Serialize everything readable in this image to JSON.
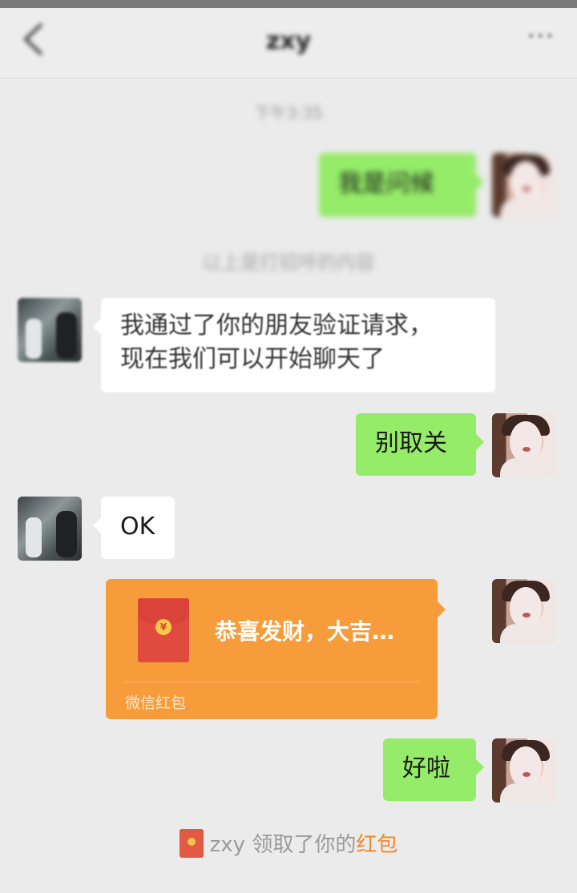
{
  "header": {
    "back_icon": "back-arrow-icon",
    "title": "zxy",
    "more_icon": "more-icon",
    "more_label": "···"
  },
  "chat": {
    "time": "下午3:35",
    "system_notice": "以上是打招呼的内容",
    "messages": [
      {
        "from": "me",
        "text": "我是问候"
      },
      {
        "from": "other",
        "line1": "我通过了你的朋友验证请求，",
        "line2": "现在我们可以开始聊天了"
      },
      {
        "from": "me",
        "text": "别取关"
      },
      {
        "from": "other",
        "text": "OK"
      },
      {
        "from": "me",
        "type": "red_packet",
        "text": "恭喜发财，大吉…",
        "label": "微信红包",
        "coin": "¥"
      },
      {
        "from": "me",
        "text": "好啦"
      }
    ],
    "receipt": {
      "name": "zxy",
      "text": " 领取了你的",
      "link": "红包"
    }
  },
  "colors": {
    "background": "#ebebeb",
    "bubble_me": "#95ec69",
    "bubble_other": "#ffffff",
    "red_packet": "#f79c3b",
    "link": "#f08a2a"
  }
}
